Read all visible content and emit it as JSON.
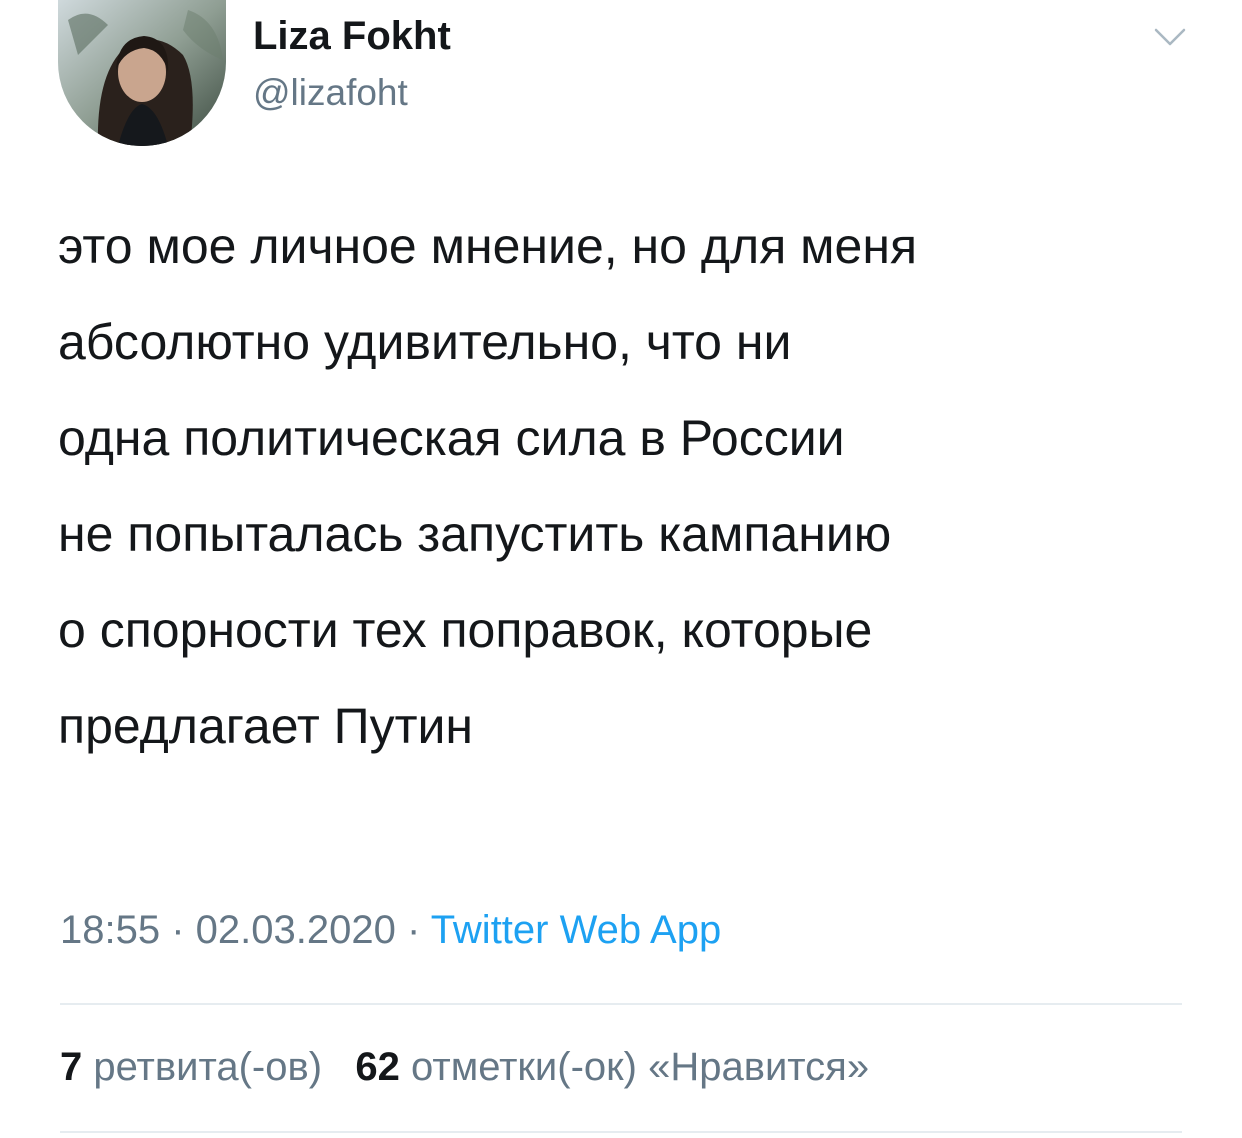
{
  "author": {
    "display_name": "Liza Fokht",
    "handle": "@lizafoht",
    "avatar_icon": "profile-photo"
  },
  "menu": {
    "icon": "chevron-down-icon"
  },
  "tweet": {
    "lines": [
      "это мое личное мнение, но для меня",
      "абсолютно удивительно, что ни",
      "одна политическая сила в России",
      "не попыталась запустить кампанию",
      "о спорности тех поправок, которые",
      "предлагает Путин"
    ]
  },
  "meta": {
    "time": "18:55",
    "separator1": " · ",
    "date": "02.03.2020",
    "separator2": " · ",
    "source": "Twitter Web App"
  },
  "stats": {
    "retweets_count": "7",
    "retweets_label": "ретвита(-ов)",
    "likes_count": "62",
    "likes_label": "отметки(-ок) «Нравится»"
  },
  "colors": {
    "text": "#14171a",
    "secondary": "#657786",
    "link": "#1da1f2",
    "divider": "#e6ecf0"
  }
}
